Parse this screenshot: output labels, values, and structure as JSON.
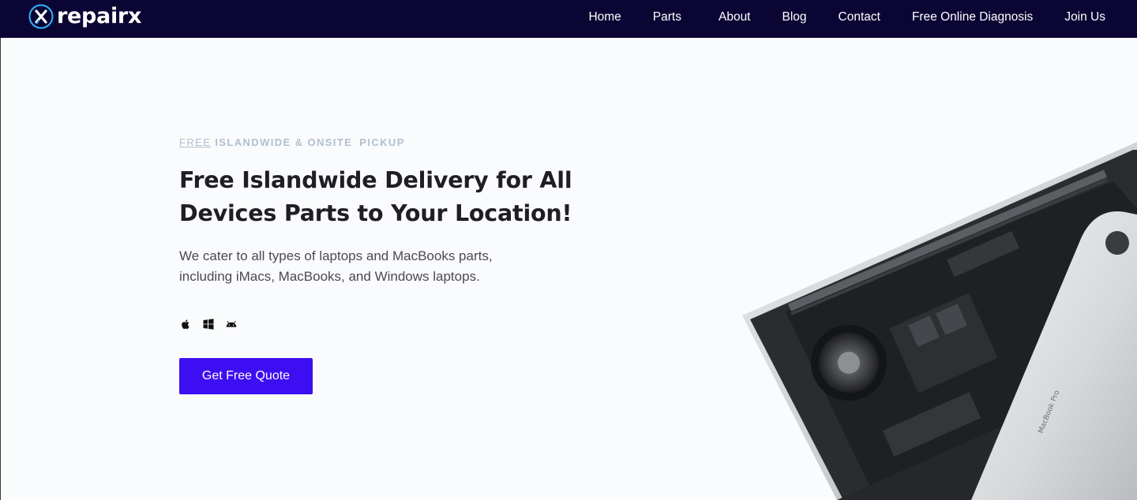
{
  "header": {
    "logo_text": "repairx",
    "nav": [
      {
        "label": "Home"
      },
      {
        "label": "Parts"
      },
      {
        "label": "About"
      },
      {
        "label": "Blog"
      },
      {
        "label": "Contact"
      },
      {
        "label": "Free Online Diagnosis"
      },
      {
        "label": "Join Us"
      }
    ]
  },
  "hero": {
    "tagline": {
      "free": "FREE",
      "islandwide": "ISLANDWIDE & ONSITE",
      "pickup": "PICKUP"
    },
    "title_line1": "Free Islandwide Delivery for All",
    "title_line2": "Devices Parts to Your Location!",
    "description_line1": "We cater to all types of laptops and MacBooks parts,",
    "description_line2": "including iMacs, MacBooks, and Windows laptops.",
    "os_icons": [
      "apple-icon",
      "windows-icon",
      "android-icon"
    ],
    "cta_label": "Get Free Quote",
    "laptop_label": "MacBook Pro"
  },
  "colors": {
    "nav_background": "#0b0534",
    "accent": "#3d0ef2",
    "page_background": "#fafbfd",
    "tagline": "#b0c0cf",
    "heading": "#1e1e24"
  }
}
